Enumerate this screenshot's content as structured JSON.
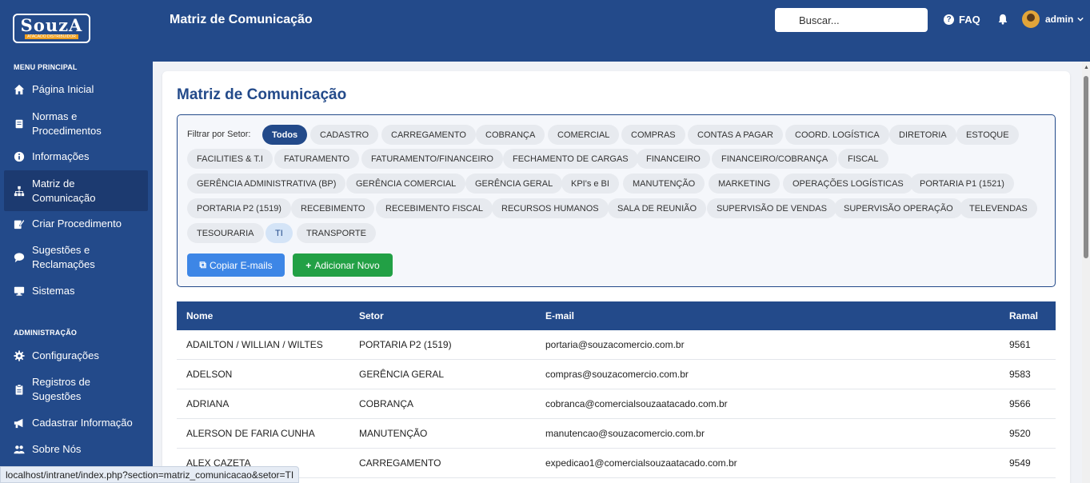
{
  "logo": {
    "text": "SouzA",
    "subtext": "ATACADO DISTRIBUIDOR"
  },
  "sidebar": {
    "sections": [
      {
        "title": "MENU PRINCIPAL"
      },
      {
        "title": "ADMINISTRAÇÃO"
      }
    ],
    "items": [
      {
        "label": "Página Inicial",
        "icon": "home-icon"
      },
      {
        "label": "Normas e Procedimentos",
        "icon": "book-icon"
      },
      {
        "label": "Informações",
        "icon": "info-icon"
      },
      {
        "label": "Matriz de Comunicação",
        "icon": "sitemap-icon"
      },
      {
        "label": "Criar Procedimento",
        "icon": "edit-icon"
      },
      {
        "label": "Sugestões e Reclamações",
        "icon": "comment-icon"
      },
      {
        "label": "Sistemas",
        "icon": "desktop-icon"
      },
      {
        "label": "Configurações",
        "icon": "gear-icon"
      },
      {
        "label": "Registros de Sugestões",
        "icon": "clipboard-icon"
      },
      {
        "label": "Cadastrar Informação",
        "icon": "megaphone-icon"
      },
      {
        "label": "Sobre Nós",
        "icon": "users-icon"
      }
    ]
  },
  "header": {
    "title": "Matriz de Comunicação",
    "search_placeholder": "Buscar...",
    "faq": "FAQ",
    "user": "admin"
  },
  "main": {
    "title": "Matriz de Comunicação",
    "filter_label": "Filtrar por Setor:",
    "chips": [
      "Todos",
      "CADASTRO",
      "CARREGAMENTO",
      "COBRANÇA",
      "COMERCIAL",
      "COMPRAS",
      "CONTAS A PAGAR",
      "COORD. LOGÍSTICA",
      "DIRETORIA",
      "ESTOQUE",
      "FACILITIES & T.I",
      "FATURAMENTO",
      "FATURAMENTO/FINANCEIRO",
      "FECHAMENTO DE CARGAS",
      "FINANCEIRO",
      "FINANCEIRO/COBRANÇA",
      "FISCAL",
      "GERÊNCIA ADMINISTRATIVA (BP)",
      "GERÊNCIA COMERCIAL",
      "GERÊNCIA GERAL",
      "KPI's e BI",
      "MANUTENÇÃO",
      "MARKETING",
      "OPERAÇÕES LOGÍSTICAS",
      "PORTARIA P1 (1521)",
      "PORTARIA P2 (1519)",
      "RECEBIMENTO",
      "RECEBIMENTO FISCAL",
      "RECURSOS HUMANOS",
      "SALA DE REUNIÃO",
      "SUPERVISÃO DE VENDAS",
      "SUPERVISÃO OPERAÇÃO",
      "TELEVENDAS",
      "TESOURARIA",
      "TI",
      "TRANSPORTE"
    ],
    "active_chip": "Todos",
    "selected_chip": "TI",
    "copy_button": "Copiar E-mails",
    "add_button": "Adicionar Novo",
    "table": {
      "headers": [
        "Nome",
        "Setor",
        "E-mail",
        "Ramal"
      ],
      "rows": [
        [
          "ADAILTON / WILLIAN / WILTES",
          "PORTARIA P2 (1519)",
          "portaria@souzacomercio.com.br",
          "9561"
        ],
        [
          "ADELSON",
          "GERÊNCIA GERAL",
          "compras@souzacomercio.com.br",
          "9583"
        ],
        [
          "ADRIANA",
          "COBRANÇA",
          "cobranca@comercialsouzaatacado.com.br",
          "9566"
        ],
        [
          "ALERSON DE FARIA CUNHA",
          "MANUTENÇÃO",
          "manutencao@souzacomercio.com.br",
          "9520"
        ],
        [
          "ALEX CAZETA",
          "CARREGAMENTO",
          "expedicao1@comercialsouzaatacado.com.br",
          "9549"
        ]
      ]
    }
  },
  "status_url": "localhost/intranet/index.php?section=matriz_comunicacao&setor=TI",
  "colors": {
    "primary": "#234a8a",
    "copy": "#3d86e6",
    "add": "#22a045"
  }
}
